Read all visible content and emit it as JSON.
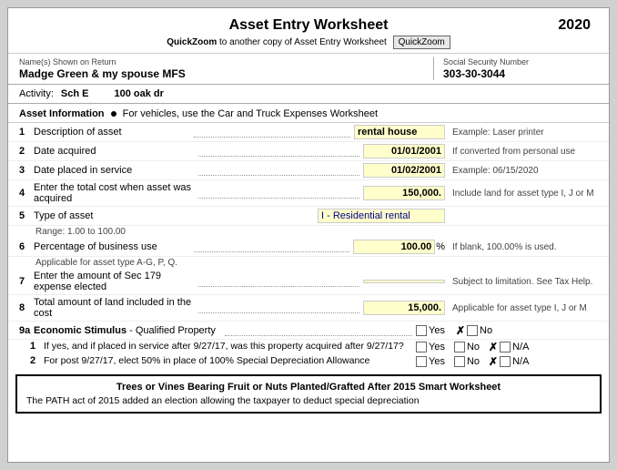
{
  "header": {
    "title": "Asset Entry Worksheet",
    "year": "2020",
    "quickzoom_text": "QuickZoom",
    "quickzoom_link": "to another copy of Asset Entry Worksheet",
    "quickzoom_btn": "QuickZoom"
  },
  "taxpayer": {
    "name_label": "Name(s) Shown on Return",
    "name_value": "Madge Green & my spouse MFS",
    "ssn_label": "Social Security Number",
    "ssn_value": "303-30-3044"
  },
  "activity": {
    "label": "Activity:",
    "value1": "Sch E",
    "value2": "100 oak dr"
  },
  "asset_info": {
    "header": "Asset Information",
    "sub": "For vehicles, use the Car and Truck Expenses Worksheet"
  },
  "rows": [
    {
      "num": "1",
      "label": "Description of asset",
      "value": "rental house",
      "note": "Example: Laser printer",
      "has_dots": true
    },
    {
      "num": "2",
      "label": "Date acquired",
      "value": "01/01/2001",
      "note": "If converted from personal use",
      "has_dots": true
    },
    {
      "num": "3",
      "label": "Date placed in service",
      "value": "01/02/2001",
      "note": "Example: 06/15/2020",
      "has_dots": true
    },
    {
      "num": "4",
      "label": "Enter the total cost when asset was acquired",
      "value": "150,000.",
      "note": "Include land for asset type I, J or M",
      "has_dots": true
    },
    {
      "num": "5",
      "label": "Type of asset",
      "value": "I - Residential rental",
      "note": "",
      "has_dots": false
    }
  ],
  "range_note": "Range: 1.00 to 100.00",
  "row6": {
    "num": "6",
    "label": "Percentage of business use",
    "value": "100.00",
    "note1": "If blank, 100.00% is used.",
    "note2": "Applicable for asset type A-G, P, Q."
  },
  "row7": {
    "num": "7",
    "label": "Enter the amount of Sec 179 expense elected",
    "note": "Subject to limitation. See Tax Help."
  },
  "row8": {
    "num": "8",
    "label": "Total amount of land included in the cost",
    "value": "15,000.",
    "note": "Applicable for asset type I, J or M"
  },
  "row9a": {
    "num": "9a",
    "label": "Economic Stimulus",
    "label2": " - Qualified Property",
    "yes_label": "Yes",
    "no_label": "No",
    "no_checked": true
  },
  "row9a_sub1": {
    "num": "1",
    "label": "If yes, and if placed in service after 9/27/17, was this property acquired after 9/27/17?",
    "yes_label": "Yes",
    "no_label": "No",
    "na_label": "N/A",
    "na_checked": true
  },
  "row9a_sub2": {
    "num": "2",
    "label": "For post 9/27/17, elect 50% in place of 100% Special Depreciation Allowance",
    "yes_label": "Yes",
    "no_label": "No",
    "na_label": "N/A",
    "na_checked": true
  },
  "bottom_box": {
    "title": "Trees or Vines Bearing Fruit or Nuts Planted/Grafted After 2015 Smart Worksheet",
    "text": "The PATH act of 2015 added an election allowing the taxpayer to deduct special depreciation"
  }
}
